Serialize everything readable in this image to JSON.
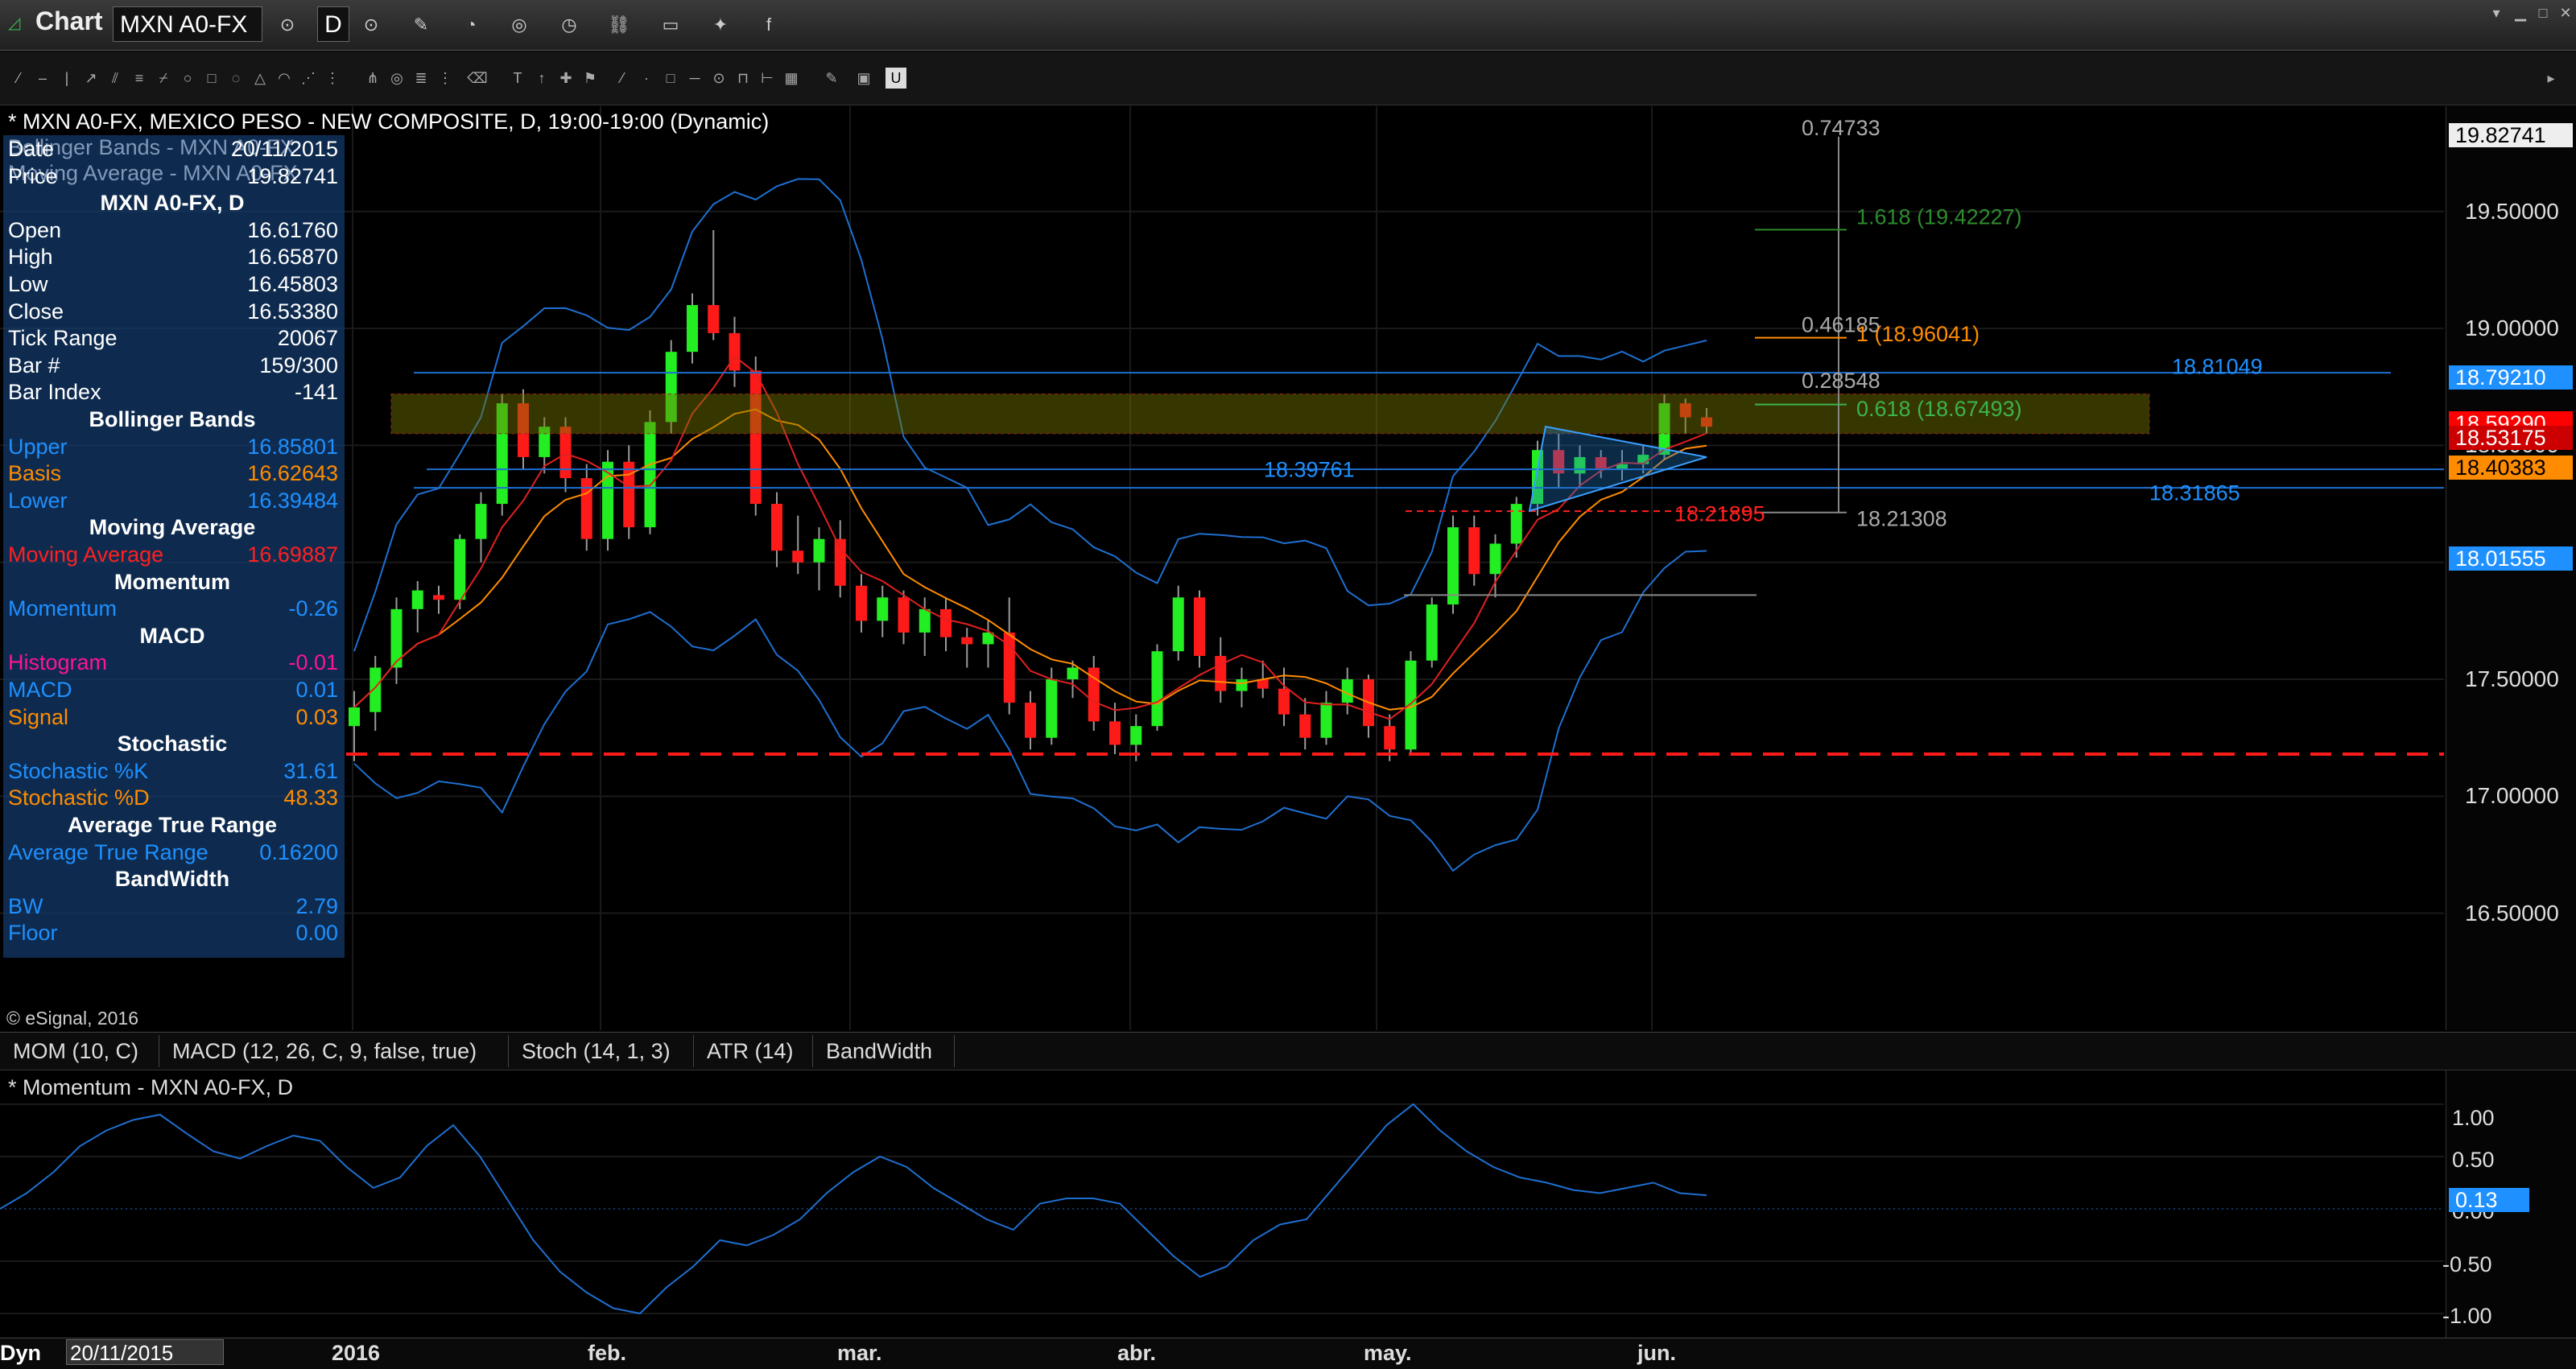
{
  "window": {
    "title": "Chart",
    "symbol": "MXN A0-FX",
    "interval": "D"
  },
  "chart": {
    "header": "* MXN A0-FX, MEXICO PESO - NEW COMPOSITE, D, 19:00-19:00 (Dynamic)",
    "overlay_legend": [
      "Bollinger Bands - MXN A0-FX",
      "Moving Average - MXN A0-FX"
    ],
    "watermark": "© eSignal, 2016",
    "price_ticks": [
      "19.82741",
      "19.50000",
      "19.00000",
      "18.50000",
      "18.01555",
      "17.50000",
      "17.00000",
      "16.50000"
    ],
    "price_axis_tags": [
      {
        "text": "19.82741",
        "price": 19.82741,
        "bg": "#eeeeee",
        "fg": "#000000"
      },
      {
        "text": "18.79210",
        "price": 18.7921,
        "bg": "#1e90ff",
        "fg": "#ffffff"
      },
      {
        "text": "18.59290",
        "price": 18.5929,
        "bg": "#ff0000",
        "fg": "#ffffff"
      },
      {
        "text": "18.53175",
        "price": 18.53175,
        "bg": "#cc0000",
        "fg": "#ffffff"
      },
      {
        "text": "18.40383",
        "price": 18.40383,
        "bg": "#ff8c00",
        "fg": "#000000"
      },
      {
        "text": "18.01555",
        "price": 18.01555,
        "bg": "#1e90ff",
        "fg": "#ffffff"
      }
    ],
    "annotations": [
      {
        "text": "0.74733",
        "color": "#aaaaaa"
      },
      {
        "text": "1.618 (19.42227)",
        "color": "#2e8b2e"
      },
      {
        "text": "0.46185",
        "color": "#aaaaaa"
      },
      {
        "text": "1 (18.96041)",
        "color": "#ff8c00"
      },
      {
        "text": "0.28548",
        "color": "#aaaaaa"
      },
      {
        "text": "18.81049",
        "color": "#1e90ff"
      },
      {
        "text": "0.618 (18.67493)",
        "color": "#3cb44b"
      },
      {
        "text": "18.39761",
        "color": "#1e90ff"
      },
      {
        "text": "18.31865",
        "color": "#1e90ff"
      },
      {
        "text": "18.21895",
        "color": "#ff2020"
      },
      {
        "text": "18.21308",
        "color": "#aaaaaa"
      }
    ],
    "date_labels": [
      "2016",
      "feb.",
      "mar.",
      "abr.",
      "may.",
      "jun."
    ],
    "support_level": 17.18,
    "resistance_zone": [
      18.55,
      18.72
    ]
  },
  "data_window": {
    "rows": [
      {
        "label": "Date",
        "value": "20/11/2015",
        "color": "#ffffff"
      },
      {
        "label": "Price",
        "value": "19.82741",
        "color": "#ffffff"
      },
      {
        "header": "MXN A0-FX, D"
      },
      {
        "label": "Open",
        "value": "16.61760",
        "color": "#ffffff"
      },
      {
        "label": "High",
        "value": "16.65870",
        "color": "#ffffff"
      },
      {
        "label": "Low",
        "value": "16.45803",
        "color": "#ffffff"
      },
      {
        "label": "Close",
        "value": "16.53380",
        "color": "#ffffff"
      },
      {
        "label": "Tick Range",
        "value": "20067",
        "color": "#ffffff"
      },
      {
        "label": "Bar #",
        "value": "159/300",
        "color": "#ffffff"
      },
      {
        "label": "Bar Index",
        "value": "-141",
        "color": "#ffffff"
      },
      {
        "header": "Bollinger Bands"
      },
      {
        "label": "Upper",
        "value": "16.85801",
        "color": "#1e90ff"
      },
      {
        "label": "Basis",
        "value": "16.62643",
        "color": "#ff8c00"
      },
      {
        "label": "Lower",
        "value": "16.39484",
        "color": "#1e90ff"
      },
      {
        "header": "Moving Average"
      },
      {
        "label": "Moving Average",
        "value": "16.69887",
        "color": "#ff2020"
      },
      {
        "header": "Momentum"
      },
      {
        "label": "Momentum",
        "value": "-0.26",
        "color": "#1e90ff"
      },
      {
        "header": "MACD"
      },
      {
        "label": "Histogram",
        "value": "-0.01",
        "color": "#ff1493"
      },
      {
        "label": "MACD",
        "value": "0.01",
        "color": "#1e90ff"
      },
      {
        "label": "Signal",
        "value": "0.03",
        "color": "#ff8c00"
      },
      {
        "header": "Stochastic"
      },
      {
        "label": "Stochastic %K",
        "value": "31.61",
        "color": "#1e90ff"
      },
      {
        "label": "Stochastic %D",
        "value": "48.33",
        "color": "#ff8c00"
      },
      {
        "header": "Average True Range"
      },
      {
        "label": "Average True Range",
        "value": "0.16200",
        "color": "#1e90ff"
      },
      {
        "header": "BandWidth"
      },
      {
        "label": "BW",
        "value": "2.79",
        "color": "#1e90ff"
      },
      {
        "label": "Floor",
        "value": "0.00",
        "color": "#1e90ff"
      }
    ]
  },
  "study_tabs": [
    "MOM (10, C)",
    "MACD (12, 26, C, 9, false, true)",
    "Stoch (14, 1, 3)",
    "ATR (14)",
    "BandWidth"
  ],
  "momentum_panel": {
    "title": "* Momentum - MXN A0-FX, D",
    "ticks": [
      "1.00",
      "0.50",
      "0.00",
      "-0.50",
      "-1.00"
    ],
    "current": "0.13"
  },
  "footer": {
    "mode": "Dyn",
    "date": "20/11/2015"
  },
  "chart_data": {
    "type": "candlestick",
    "title": "* MXN A0-FX, MEXICO PESO - NEW COMPOSITE, D, 19:00-19:00 (Dynamic)",
    "ylim": [
      16.0,
      19.95
    ],
    "x_labels": [
      "2016",
      "feb.",
      "mar.",
      "abr.",
      "may.",
      "jun."
    ],
    "candles": [
      [
        17.3,
        17.45,
        17.15,
        17.38
      ],
      [
        17.36,
        17.6,
        17.28,
        17.55
      ],
      [
        17.55,
        17.85,
        17.48,
        17.8
      ],
      [
        17.8,
        17.92,
        17.7,
        17.88
      ],
      [
        17.86,
        17.9,
        17.78,
        17.84
      ],
      [
        17.84,
        18.12,
        17.8,
        18.1
      ],
      [
        18.1,
        18.3,
        18.0,
        18.25
      ],
      [
        18.25,
        18.72,
        18.2,
        18.68
      ],
      [
        18.68,
        18.74,
        18.4,
        18.45
      ],
      [
        18.45,
        18.62,
        18.38,
        18.58
      ],
      [
        18.58,
        18.62,
        18.3,
        18.36
      ],
      [
        18.36,
        18.42,
        18.05,
        18.1
      ],
      [
        18.1,
        18.48,
        18.05,
        18.43
      ],
      [
        18.43,
        18.5,
        18.1,
        18.15
      ],
      [
        18.15,
        18.65,
        18.12,
        18.6
      ],
      [
        18.6,
        18.95,
        18.55,
        18.9
      ],
      [
        18.9,
        19.15,
        18.85,
        19.1
      ],
      [
        19.1,
        19.42,
        18.95,
        18.98
      ],
      [
        18.98,
        19.05,
        18.75,
        18.82
      ],
      [
        18.82,
        18.88,
        18.2,
        18.25
      ],
      [
        18.25,
        18.3,
        17.98,
        18.05
      ],
      [
        18.05,
        18.2,
        17.95,
        18.0
      ],
      [
        18.0,
        18.15,
        17.88,
        18.1
      ],
      [
        18.1,
        18.18,
        17.85,
        17.9
      ],
      [
        17.9,
        17.95,
        17.7,
        17.75
      ],
      [
        17.75,
        17.9,
        17.68,
        17.85
      ],
      [
        17.85,
        17.88,
        17.65,
        17.7
      ],
      [
        17.7,
        17.85,
        17.6,
        17.8
      ],
      [
        17.8,
        17.85,
        17.62,
        17.68
      ],
      [
        17.68,
        17.72,
        17.55,
        17.65
      ],
      [
        17.65,
        17.75,
        17.55,
        17.7
      ],
      [
        17.7,
        17.85,
        17.35,
        17.4
      ],
      [
        17.4,
        17.45,
        17.2,
        17.25
      ],
      [
        17.25,
        17.55,
        17.22,
        17.5
      ],
      [
        17.5,
        17.58,
        17.42,
        17.55
      ],
      [
        17.55,
        17.6,
        17.28,
        17.32
      ],
      [
        17.32,
        17.4,
        17.18,
        17.22
      ],
      [
        17.22,
        17.35,
        17.15,
        17.3
      ],
      [
        17.3,
        17.65,
        17.28,
        17.62
      ],
      [
        17.62,
        17.9,
        17.58,
        17.85
      ],
      [
        17.85,
        17.88,
        17.55,
        17.6
      ],
      [
        17.6,
        17.68,
        17.4,
        17.45
      ],
      [
        17.45,
        17.55,
        17.38,
        17.5
      ],
      [
        17.5,
        17.58,
        17.42,
        17.46
      ],
      [
        17.46,
        17.55,
        17.3,
        17.35
      ],
      [
        17.35,
        17.42,
        17.2,
        17.25
      ],
      [
        17.25,
        17.45,
        17.22,
        17.4
      ],
      [
        17.4,
        17.55,
        17.35,
        17.5
      ],
      [
        17.5,
        17.52,
        17.25,
        17.3
      ],
      [
        17.3,
        17.35,
        17.15,
        17.2
      ],
      [
        17.2,
        17.62,
        17.18,
        17.58
      ],
      [
        17.58,
        17.85,
        17.55,
        17.82
      ],
      [
        17.82,
        18.2,
        17.78,
        18.15
      ],
      [
        18.15,
        18.2,
        17.9,
        17.95
      ],
      [
        17.95,
        18.12,
        17.85,
        18.08
      ],
      [
        18.08,
        18.28,
        18.02,
        18.25
      ],
      [
        18.25,
        18.52,
        18.2,
        18.48
      ],
      [
        18.48,
        18.55,
        18.32,
        18.38
      ],
      [
        18.38,
        18.5,
        18.32,
        18.45
      ],
      [
        18.45,
        18.48,
        18.36,
        18.4
      ],
      [
        18.4,
        18.48,
        18.35,
        18.42
      ],
      [
        18.42,
        18.5,
        18.38,
        18.46
      ],
      [
        18.46,
        18.72,
        18.44,
        18.68
      ],
      [
        18.68,
        18.7,
        18.55,
        18.62
      ],
      [
        18.62,
        18.66,
        18.55,
        18.58
      ]
    ],
    "momentum": [
      0.0,
      0.15,
      0.35,
      0.6,
      0.75,
      0.85,
      0.9,
      0.72,
      0.55,
      0.48,
      0.6,
      0.7,
      0.65,
      0.4,
      0.2,
      0.3,
      0.6,
      0.8,
      0.5,
      0.1,
      -0.3,
      -0.6,
      -0.8,
      -0.95,
      -1.0,
      -0.75,
      -0.55,
      -0.3,
      -0.35,
      -0.25,
      -0.1,
      0.15,
      0.35,
      0.5,
      0.4,
      0.2,
      0.05,
      -0.1,
      -0.2,
      0.05,
      0.1,
      0.1,
      0.05,
      -0.2,
      -0.45,
      -0.65,
      -0.55,
      -0.3,
      -0.15,
      -0.1,
      0.2,
      0.5,
      0.8,
      1.0,
      0.75,
      0.55,
      0.4,
      0.3,
      0.25,
      0.18,
      0.15,
      0.2,
      0.25,
      0.15,
      0.13
    ]
  }
}
